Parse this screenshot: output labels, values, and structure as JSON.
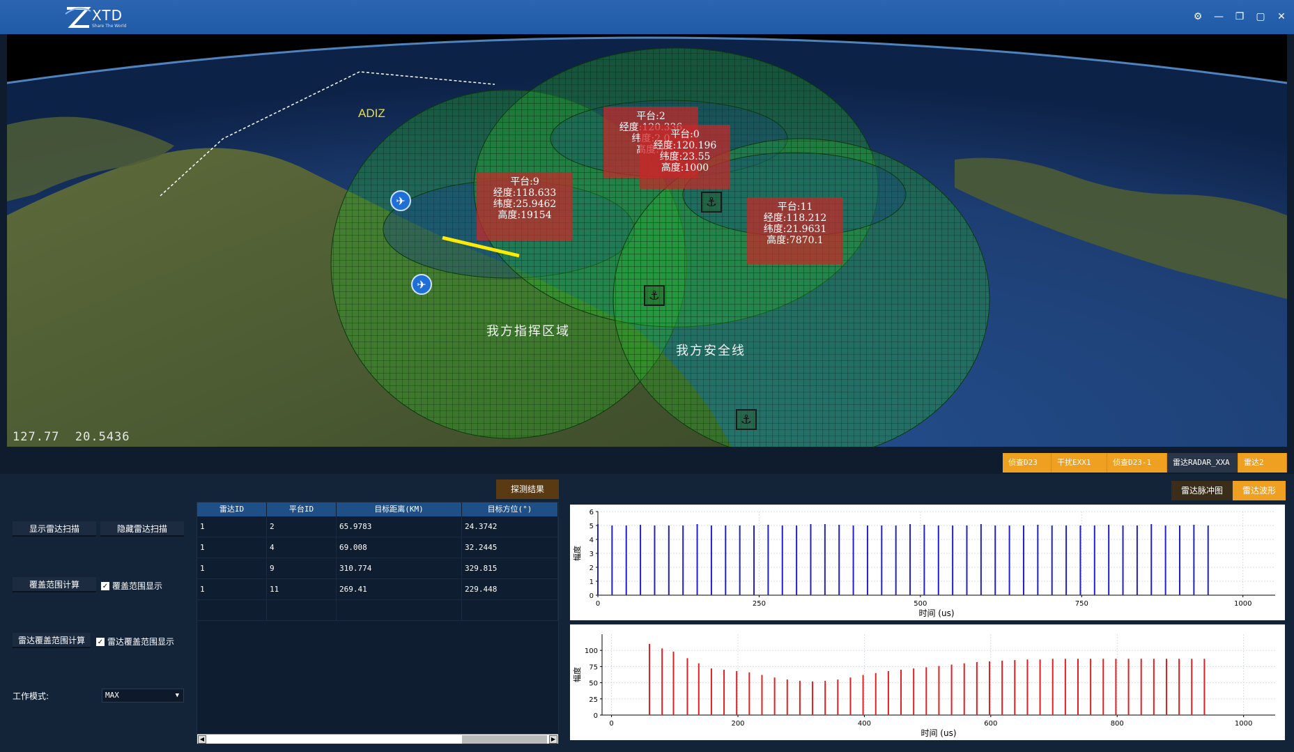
{
  "app": {
    "logo_text": "XTD",
    "logo_sub": "Share The World"
  },
  "window": {
    "controls": [
      "settings-icon",
      "minimize-icon",
      "restore-icon",
      "maximize-icon",
      "close-icon"
    ]
  },
  "map": {
    "coord_readout": "127.77  20.5436",
    "adiz_label": "ADIZ",
    "zone_labels": [
      "我方指挥区域",
      "我方安全线"
    ],
    "platforms": [
      {
        "lines": [
          "平台:2",
          "经度:120.336",
          "纬度:2.0",
          "高度:1"
        ]
      },
      {
        "lines": [
          "平台:0",
          "经度:120.196",
          "纬度:23.55",
          "高度:1000"
        ]
      },
      {
        "lines": [
          "平台:9",
          "经度:118.633",
          "纬度:25.9462",
          "高度:19154"
        ]
      },
      {
        "lines": [
          "平台:11",
          "经度:118.212",
          "纬度:21.9631",
          "高度:7870.1"
        ]
      }
    ]
  },
  "tabs_top": [
    {
      "label": "侦查D23",
      "active": false
    },
    {
      "label": "干扰EXX1",
      "active": false
    },
    {
      "label": "侦查D23-1",
      "active": false
    },
    {
      "label": "雷达RADAR_XXA",
      "active": true
    },
    {
      "label": "雷达2",
      "active": false
    }
  ],
  "controls": {
    "show_scan": "显示雷达扫描",
    "hide_scan": "隐藏雷达扫描",
    "coverage_calc": "覆盖范围计算",
    "coverage_show": "覆盖范围显示",
    "radar_coverage_calc": "雷达覆盖范围计算",
    "radar_coverage_show": "雷达覆盖范围显示",
    "work_mode_label": "工作模式:",
    "work_mode_value": "MAX",
    "result_button": "探测结果"
  },
  "table": {
    "headers": [
      "雷达ID",
      "平台ID",
      "目标距离(KM)",
      "目标方位(°)"
    ],
    "rows": [
      [
        "1",
        "2",
        "65.9783",
        "24.3742"
      ],
      [
        "1",
        "4",
        "69.008",
        "32.2445"
      ],
      [
        "1",
        "9",
        "310.774",
        "329.815"
      ],
      [
        "1",
        "11",
        "269.41",
        "229.448"
      ]
    ]
  },
  "wave_tabs": [
    "雷达脉冲图",
    "雷达波形"
  ],
  "chart_data": [
    {
      "type": "bar",
      "color": "#2020c8",
      "xlabel": "时间 (us)",
      "ylabel": "幅度",
      "xlim": [
        0,
        1050
      ],
      "ylim": [
        0,
        6
      ],
      "xticks": [
        0,
        250,
        500,
        750,
        1000
      ],
      "yticks": [
        0,
        1,
        2,
        3,
        4,
        5,
        6
      ],
      "grid": true,
      "x": [
        0,
        22,
        44,
        66,
        88,
        110,
        132,
        154,
        176,
        198,
        220,
        242,
        264,
        286,
        308,
        330,
        352,
        374,
        396,
        418,
        440,
        462,
        484,
        506,
        528,
        550,
        572,
        594,
        616,
        638,
        660,
        682,
        704,
        726,
        748,
        770,
        792,
        814,
        836,
        858,
        880,
        902,
        924,
        946
      ],
      "values": [
        5.1,
        5,
        5,
        5.05,
        5,
        5,
        5,
        5.1,
        5,
        5,
        5,
        5,
        5.05,
        5,
        5,
        5.1,
        5.1,
        5.05,
        5,
        5,
        5,
        5,
        5.1,
        5.05,
        5,
        5,
        5,
        5.1,
        5,
        5,
        5,
        5.05,
        5,
        5,
        5,
        5,
        5.05,
        5,
        5,
        5.1,
        5,
        5,
        5.05,
        5
      ]
    },
    {
      "type": "bar",
      "color": "#e02020",
      "xlabel": "时间 (us)",
      "ylabel": "幅度",
      "xlim": [
        -15,
        1050
      ],
      "ylim": [
        0,
        125
      ],
      "xticks": [
        0,
        200,
        400,
        600,
        800,
        1000
      ],
      "yticks": [
        0,
        25,
        50,
        75,
        100
      ],
      "grid": true,
      "x": [
        60,
        80,
        98,
        120,
        138,
        158,
        178,
        198,
        218,
        238,
        258,
        278,
        298,
        318,
        338,
        358,
        378,
        398,
        418,
        438,
        458,
        478,
        498,
        518,
        538,
        558,
        578,
        598,
        618,
        638,
        658,
        678,
        698,
        718,
        738,
        758,
        778,
        798,
        818,
        838,
        858,
        878,
        898,
        918,
        938
      ],
      "values": [
        110,
        103,
        98,
        88,
        80,
        72,
        70,
        68,
        66,
        62,
        58,
        55,
        53,
        52,
        53,
        55,
        58,
        62,
        65,
        68,
        70,
        72,
        74,
        76,
        78,
        80,
        82,
        83,
        84,
        85,
        86,
        86,
        87,
        87,
        87,
        87,
        87,
        87,
        87,
        87,
        87,
        87,
        87,
        87,
        87
      ]
    }
  ]
}
